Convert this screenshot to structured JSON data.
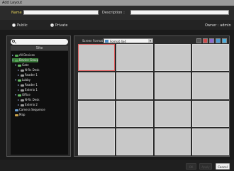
{
  "window": {
    "title": "Add Layout"
  },
  "form": {
    "name_label": "Name :",
    "name_value": "",
    "description_label": "Description :",
    "description_value": "",
    "public_label": "Public",
    "private_label": "Private",
    "owner_label": "Owner : admin"
  },
  "left": {
    "search_placeholder": "",
    "site_header": "Site",
    "tree": [
      {
        "label": "All Devices",
        "exp": "▸",
        "icon": "grp"
      },
      {
        "label": "Device Group",
        "exp": "▾",
        "icon": "grp",
        "highlight": true
      },
      {
        "label": "Gate",
        "exp": "▾",
        "icon": "sub"
      },
      {
        "label": "N-Rs Desk",
        "exp": "▸",
        "icon": "cam"
      },
      {
        "label": "Reader 1",
        "exp": "▸",
        "icon": "cam"
      },
      {
        "label": "Lobby",
        "exp": "▾",
        "icon": "sub"
      },
      {
        "label": "Reader 1",
        "exp": "▸",
        "icon": "cam"
      },
      {
        "label": "Exterio 1",
        "exp": "▸",
        "icon": "cam"
      },
      {
        "label": "Office",
        "exp": "▾",
        "icon": "sub"
      },
      {
        "label": "N-Rs Desk",
        "exp": "▸",
        "icon": "cam"
      },
      {
        "label": "Exterio 2",
        "exp": "▸",
        "icon": "cam"
      },
      {
        "label": "Camera Sequence",
        "exp": "",
        "icon": "seq"
      },
      {
        "label": "Map",
        "exp": "",
        "icon": "folder"
      }
    ]
  },
  "right": {
    "screen_format_label": "Screen Format :",
    "screen_format_value": "Format 4x4",
    "toolbar_colors": [
      "#555555",
      "#d04a4a",
      "#8a6ad0",
      "#4a9ad0",
      "#4ab0e0"
    ]
  },
  "buttons": {
    "ok": "OK",
    "apply": "Apply",
    "cancel": "Cancel"
  }
}
